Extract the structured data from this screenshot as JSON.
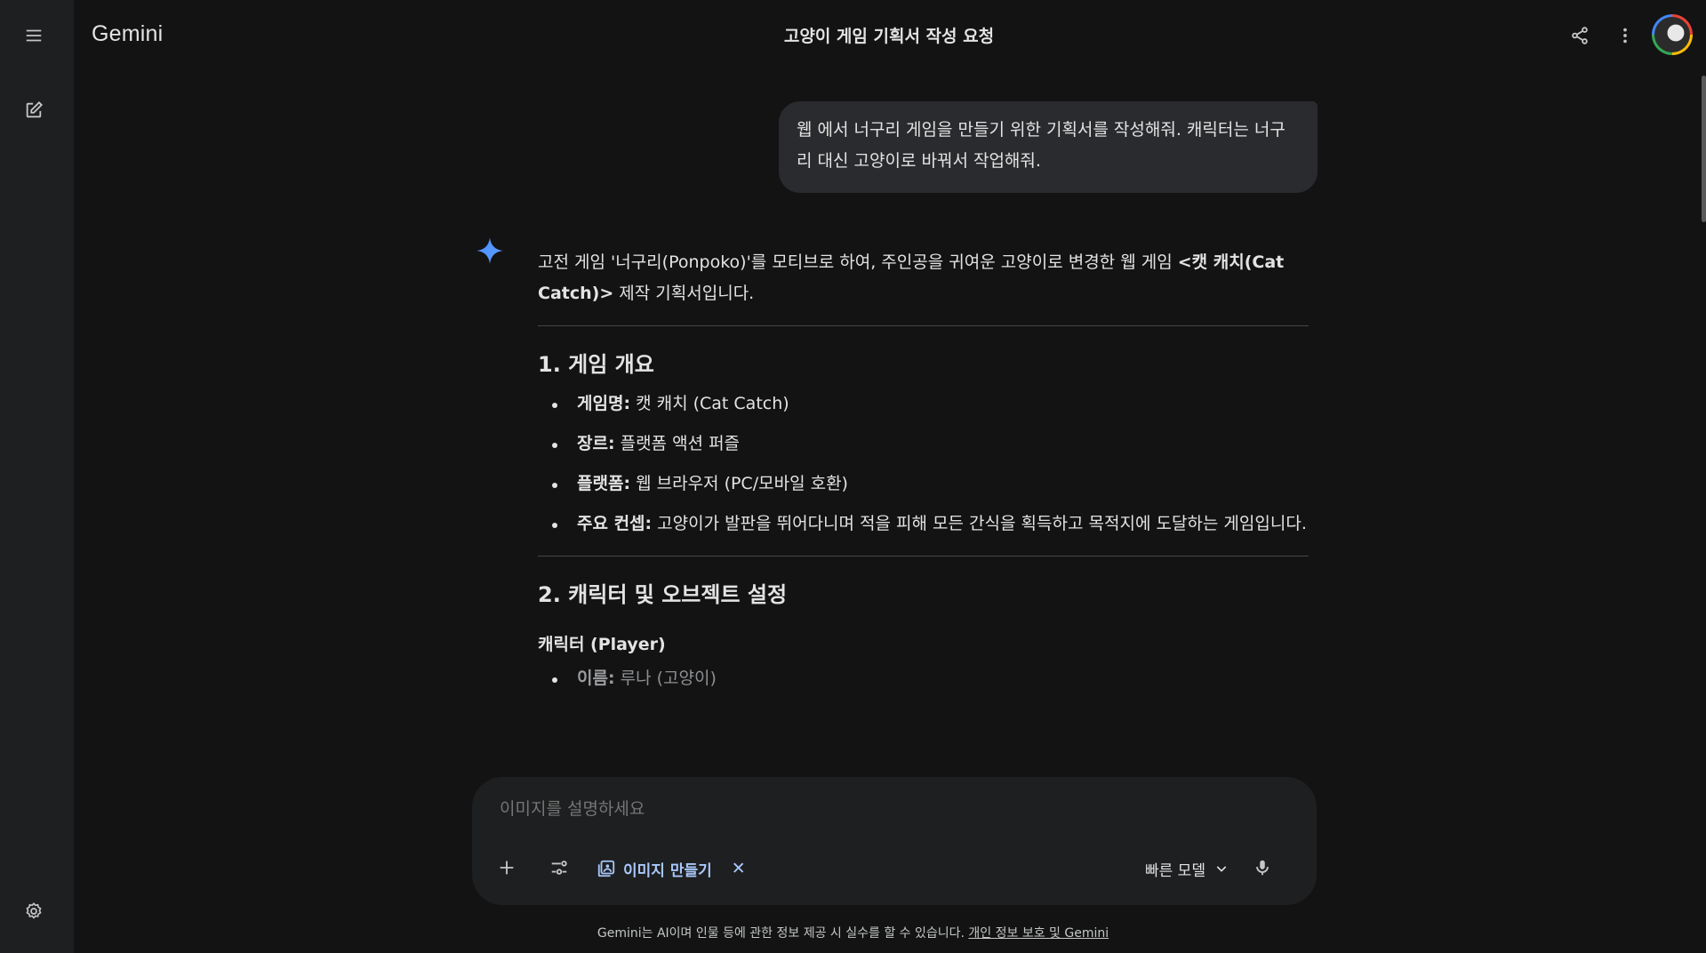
{
  "app": {
    "brand": "Gemini"
  },
  "header": {
    "title": "고양이 게임 기획서 작성 요청"
  },
  "sidebar": {
    "menu_icon": "menu-icon",
    "new_chat_icon": "edit-square-icon",
    "settings_icon": "gear-icon"
  },
  "user_message": {
    "text": "웹 에서 너구리 게임을 만들기 위한 기획서를 작성해줘. 캐릭터는 너구리 대신 고양이로 바꿔서 작업해줘."
  },
  "response": {
    "intro_plain": "고전 게임 '너구리(Ponpoko)'를 모티브로 하여, 주인공을 귀여운 고양이로 변경한 웹 게임 ",
    "intro_bold": "<캣 캐치(Cat Catch)>",
    "intro_tail": " 제작 기획서입니다.",
    "section1_title": "1. 게임 개요",
    "section1_items": [
      {
        "label": "게임명:",
        "value": " 캣 캐치 (Cat Catch)"
      },
      {
        "label": "장르:",
        "value": " 플랫폼 액션 퍼즐"
      },
      {
        "label": "플랫폼:",
        "value": " 웹 브라우저 (PC/모바일 호환)"
      },
      {
        "label": "주요 컨셉:",
        "value": " 고양이가 발판을 뛰어다니며 적을 피해 모든 간식을 획득하고 목적지에 도달하는 게임입니다."
      }
    ],
    "section2_title": "2. 캐릭터 및 오브젝트 설정",
    "subsection_title": "캐릭터 (Player)",
    "section2_items": [
      {
        "label": "이름:",
        "value": " 루나 (고양이)"
      }
    ]
  },
  "composer": {
    "placeholder": "이미지를 설명하세요",
    "tool_chip_label": "이미지 만들기",
    "tool_chip_close": "✕",
    "model_label": "빠른 모델"
  },
  "footer": {
    "disclaimer": "Gemini는 AI이며 인물 등에 관한 정보 제공 시 실수를 할 수 있습니다. ",
    "link": "개인 정보 보호 및 Gemini"
  },
  "colors": {
    "background": "#131314",
    "rail": "#1e1f20",
    "bubble": "#2a2b2e",
    "accent": "#a8c7fa"
  }
}
